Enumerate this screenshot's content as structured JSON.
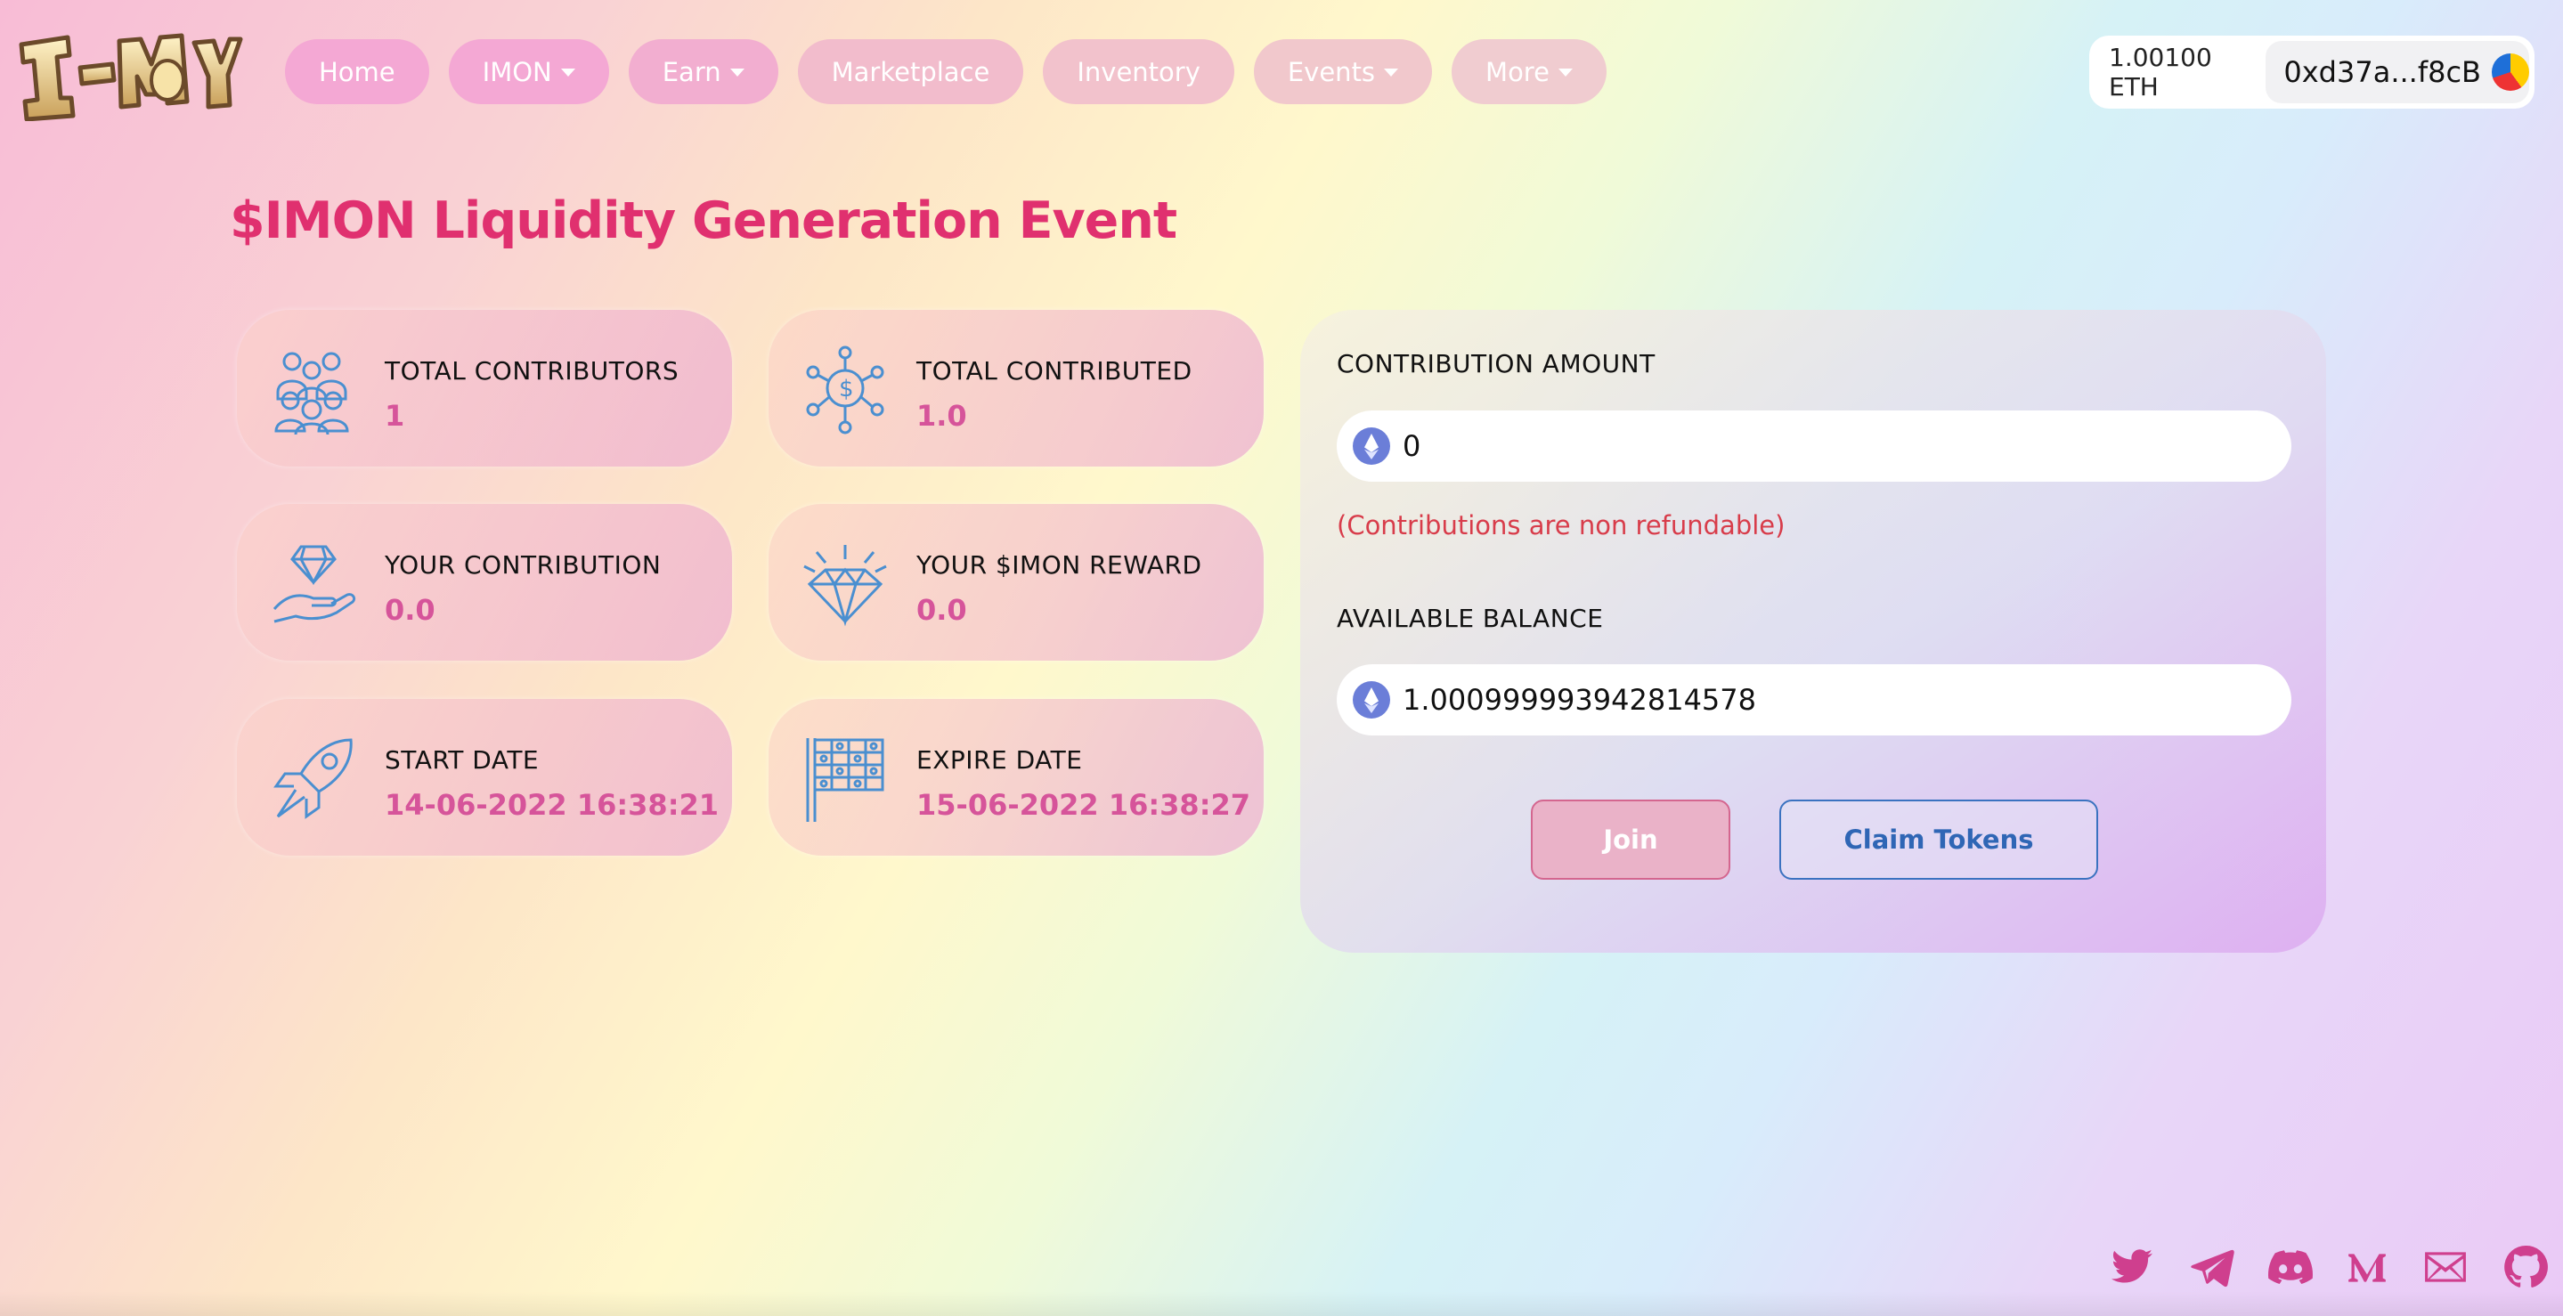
{
  "brand": {
    "logo_text": "I-MON"
  },
  "nav": {
    "items": [
      {
        "label": "Home",
        "dropdown": false,
        "bg": "#f4a8d4"
      },
      {
        "label": "IMON",
        "dropdown": true,
        "bg": "#f4a8d4"
      },
      {
        "label": "Earn",
        "dropdown": true,
        "bg": "#f2aed0"
      },
      {
        "label": "Marketplace",
        "dropdown": false,
        "bg": "#f2bccc"
      },
      {
        "label": "Inventory",
        "dropdown": false,
        "bg": "#f2c2cc"
      },
      {
        "label": "Events",
        "dropdown": true,
        "bg": "#f1c8cc"
      },
      {
        "label": "More",
        "dropdown": true,
        "bg": "#f0ccd0"
      }
    ]
  },
  "wallet": {
    "balance": "1.00100 ETH",
    "address": "0xd37a...f8cB"
  },
  "page": {
    "title": "$IMON Liquidity Generation Event"
  },
  "stats": {
    "total_contributors": {
      "label": "TOTAL CONTRIBUTORS",
      "value": "1",
      "icon": "people-icon"
    },
    "total_contributed": {
      "label": "TOTAL CONTRIBUTED",
      "value": "1.0",
      "icon": "network-dollar-icon"
    },
    "your_contribution": {
      "label": "YOUR CONTRIBUTION",
      "value": "0.0",
      "icon": "hand-diamond-icon"
    },
    "your_reward": {
      "label": "YOUR $IMON REWARD",
      "value": "0.0",
      "icon": "diamond-icon"
    },
    "start_date": {
      "label": "START DATE",
      "value": "14-06-2022 16:38:21",
      "icon": "rocket-icon"
    },
    "expire_date": {
      "label": "EXPIRE DATE",
      "value": "15-06-2022 16:38:27",
      "icon": "checkered-flag-icon"
    }
  },
  "contribution": {
    "amount_label": "CONTRIBUTION AMOUNT",
    "amount_value": "0",
    "note": "(Contributions are non refundable)",
    "balance_label": "AVAILABLE BALANCE",
    "balance_value": "1.000999993942814578",
    "join_label": "Join",
    "claim_label": "Claim Tokens"
  },
  "social": [
    "twitter-icon",
    "telegram-icon",
    "discord-icon",
    "medium-icon",
    "mail-icon",
    "github-icon"
  ],
  "colors": {
    "accent": "#e0306f",
    "value": "#d6549a",
    "social": "#cf3f8e",
    "icon_line": "#4a8fd0"
  }
}
